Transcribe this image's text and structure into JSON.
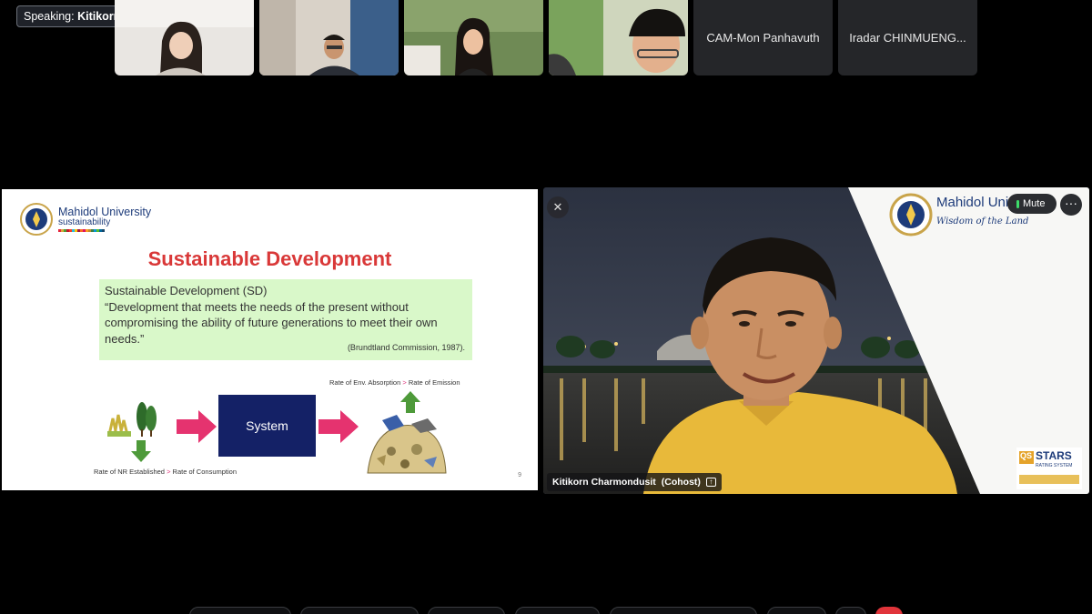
{
  "speaking": {
    "prefix": "Speaking:",
    "name": "Kitikorn Charmondusit (Co..."
  },
  "participants": [
    {
      "kind": "video",
      "label": ""
    },
    {
      "kind": "video",
      "label": ""
    },
    {
      "kind": "video",
      "label": ""
    },
    {
      "kind": "video",
      "label": ""
    },
    {
      "kind": "name",
      "label": "CAM-Mon Panhavuth"
    },
    {
      "kind": "name",
      "label": "Iradar CHINMUENG..."
    }
  ],
  "slide": {
    "logo_line1": "Mahidol University",
    "logo_line2": "sustainability",
    "title": "Sustainable Development",
    "definition_heading": "Sustainable Development (SD)",
    "definition_text": "“Development that meets the needs of the present without compromising the ability of future generations to meet their own needs.”",
    "citation": "(Brundtland Commission, 1987).",
    "rate_top_a": "Rate of Env. Absorption",
    "rate_top_b": "Rate of Emission",
    "rate_bottom_a": "Rate of NR Established",
    "rate_bottom_b": "Rate of Consumption",
    "gt": ">",
    "system_label": "System",
    "page_number": "9"
  },
  "speaker": {
    "name": "Kitikorn Charmondusit",
    "role": "(Cohost)",
    "mute_label": "Mute",
    "more_label": "···",
    "backdrop_brand": "Mahidol Uni",
    "backdrop_motto": "Wisdom of the Land",
    "stars_label": "STARS",
    "stars_sub": "RATING SYSTEM",
    "qs_label": "QS"
  },
  "colors": {
    "accent_red": "#d93838",
    "system_blue": "#142166",
    "mic_green": "#3ddc6a",
    "definition_bg": "#d9f8c9"
  }
}
